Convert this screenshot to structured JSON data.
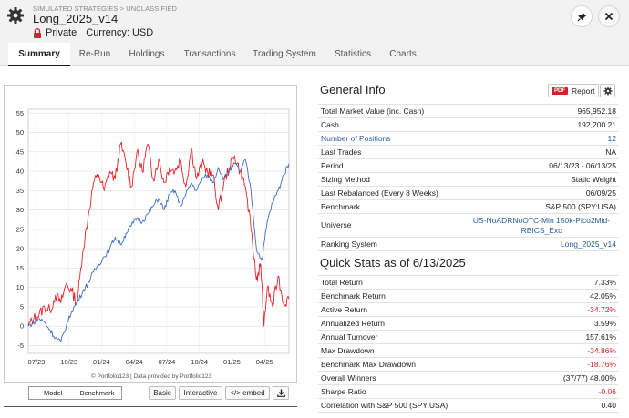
{
  "header": {
    "breadcrumb": "SIMULATED STRATEGIES > UNCLASSIFIED",
    "title": "Long_2025_v14",
    "privacy": "Private",
    "currency_label": "Currency: USD"
  },
  "tabs": [
    {
      "label": "Summary",
      "active": true
    },
    {
      "label": "Re-Run"
    },
    {
      "label": "Holdings"
    },
    {
      "label": "Transactions"
    },
    {
      "label": "Trading System"
    },
    {
      "label": "Statistics"
    },
    {
      "label": "Charts"
    }
  ],
  "chart_controls": {
    "credit": "© Portfolio123 | Data provided by Portfolio123",
    "legend_model": "Model",
    "legend_benchmark": "Benchmark",
    "btn_basic": "Basic",
    "btn_interactive": "Interactive",
    "btn_embed": "</> embed"
  },
  "colors": {
    "model": "#e8232b",
    "benchmark": "#3d6fc7",
    "accent_red": "#d0242b",
    "link": "#2a5d9f"
  },
  "chart_data": {
    "type": "line",
    "xlabel": "",
    "ylabel": "",
    "ylim": [
      -7,
      56
    ],
    "yticks": [
      -5,
      0,
      5,
      10,
      15,
      20,
      25,
      30,
      35,
      40,
      45,
      50,
      55
    ],
    "xticks": [
      "07/23",
      "10/23",
      "01/24",
      "04/24",
      "07/24",
      "10/24",
      "01/25",
      "04/25"
    ],
    "x_months_range": [
      0,
      24
    ],
    "grid": true,
    "legend": "bottom-left",
    "series": [
      {
        "name": "Model",
        "x": [
          0,
          0.5,
          1,
          1.5,
          2,
          2.5,
          3,
          3.5,
          4,
          4.5,
          5,
          5.5,
          6,
          6.5,
          7,
          7.5,
          8,
          8.5,
          9,
          9.5,
          10,
          10.5,
          11,
          11.5,
          12,
          12.5,
          13,
          13.5,
          14,
          14.5,
          15,
          15.5,
          16,
          16.5,
          17,
          17.5,
          18,
          18.5,
          19,
          19.5,
          20,
          20.5,
          21,
          21.2,
          21.4,
          21.7,
          22,
          22.5,
          23,
          23.5,
          24
        ],
        "values": [
          0,
          2,
          3,
          5,
          4,
          8,
          6,
          11,
          9,
          6,
          19,
          28,
          37,
          39,
          35,
          40,
          38,
          47,
          42,
          36,
          45,
          40,
          47,
          38,
          43,
          37,
          41,
          40,
          43,
          36,
          46,
          38,
          42,
          40,
          39,
          30,
          37,
          41,
          44,
          40,
          36,
          25,
          12,
          14,
          16,
          0,
          10,
          5,
          13,
          6,
          7
        ]
      },
      {
        "name": "Benchmark",
        "x": [
          0,
          0.5,
          1,
          1.5,
          2,
          2.5,
          3,
          3.5,
          4,
          4.5,
          5,
          5.5,
          6,
          6.5,
          7,
          7.5,
          8,
          8.5,
          9,
          9.5,
          10,
          10.5,
          11,
          11.5,
          12,
          12.5,
          13,
          13.5,
          14,
          14.5,
          15,
          15.5,
          16,
          16.5,
          17,
          17.5,
          18,
          18.5,
          19,
          19.5,
          20,
          20.5,
          21,
          21.5,
          22,
          22.5,
          23,
          23.5,
          24
        ],
        "values": [
          0,
          1,
          2,
          1,
          -1,
          -3,
          -4,
          0,
          4,
          6,
          9,
          11,
          14,
          16,
          18,
          20,
          23,
          21,
          24,
          26,
          28,
          27,
          29,
          31,
          33,
          30,
          34,
          35,
          31,
          34,
          37,
          35,
          38,
          39,
          37,
          41,
          38,
          40,
          42,
          40,
          43,
          35,
          20,
          17,
          27,
          32,
          35,
          39,
          42
        ]
      }
    ]
  },
  "general_info": {
    "title": "General Info",
    "report_badge": "PDF",
    "report_label": "Report",
    "rows": [
      {
        "label": "Total Market Value (inc. Cash)",
        "value": "965,952.18"
      },
      {
        "label": "Cash",
        "value": "192,200.21"
      },
      {
        "label": "Number of Positions",
        "value": "12",
        "link": true
      },
      {
        "label": "Last Trades",
        "value": "NA"
      },
      {
        "label": "Period",
        "value": "06/13/23 - 06/13/25"
      },
      {
        "label": "Sizing Method",
        "value": "Static Weight"
      },
      {
        "label": "Last Rebalanced (Every 8 Weeks)",
        "value": "06/09/25"
      },
      {
        "label": "Benchmark",
        "value": "S&P 500 (SPY:USA)"
      },
      {
        "label": "Universe",
        "value": "US-NoADRNoOTC-Min 150k-Pico2Mid-RBICS_Exc",
        "link": true,
        "tall": true
      },
      {
        "label": "Ranking System",
        "value": "Long_2025_v14",
        "link": true
      }
    ]
  },
  "quick_stats": {
    "title": "Quick Stats as of 6/13/2025",
    "rows": [
      {
        "label": "Total Return",
        "value": "7.33%"
      },
      {
        "label": "Benchmark Return",
        "value": "42.05%"
      },
      {
        "label": "Active Return",
        "value": "-34.72%",
        "neg": true
      },
      {
        "label": "Annualized Return",
        "value": "3.59%"
      },
      {
        "label": "Annual Turnover",
        "value": "157.61%"
      },
      {
        "label": "Max Drawdown",
        "value": "-34.86%",
        "neg": true
      },
      {
        "label": "Benchmark Max Drawdown",
        "value": "-18.76%",
        "neg": true
      },
      {
        "label": "Overall Winners",
        "value": "(37/77) 48.00%"
      },
      {
        "label": "Sharpe Ratio",
        "value": "-0.06",
        "neg": true
      },
      {
        "label": "Correlation with S&P 500 (SPY:USA)",
        "value": "0.40"
      }
    ]
  }
}
